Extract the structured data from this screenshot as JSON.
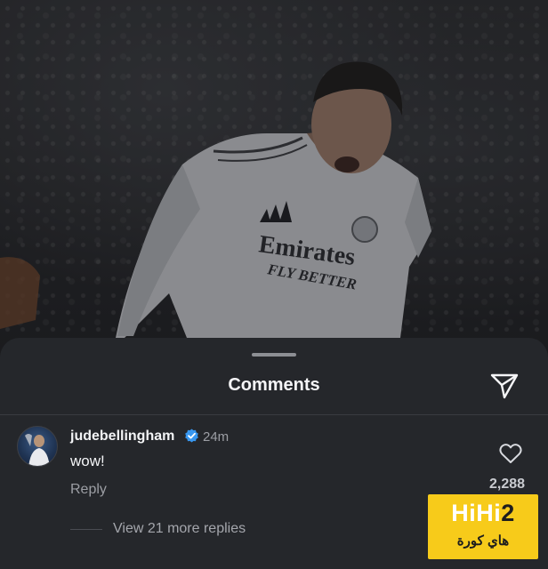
{
  "sheet": {
    "title": "Comments"
  },
  "comment": {
    "username": "judebellingham",
    "time": "24m",
    "text": "wow!",
    "reply_label": "Reply",
    "likes": "2,288",
    "view_replies": "View 21 more replies"
  },
  "watermark": {
    "top_prefix": "HiHi",
    "top_number": "2",
    "arabic": "هاي كورة"
  },
  "photo": {
    "jersey_text_1": "Emirates",
    "jersey_text_2": "FLY BETTER"
  },
  "icons": [
    "share-send-icon",
    "verified-badge-icon",
    "heart-icon"
  ],
  "colors": {
    "sheet_bg": "#25272b",
    "verified": "#3897f0",
    "logo_bg": "#f7cb1a"
  }
}
